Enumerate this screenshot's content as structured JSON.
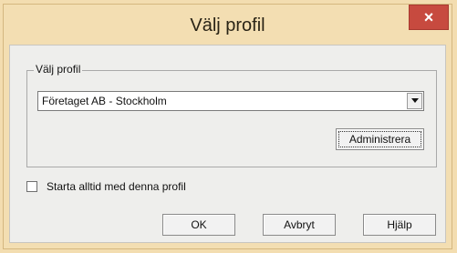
{
  "window": {
    "title": "Välj profil",
    "close_glyph": "×"
  },
  "group": {
    "legend": "Välj profil",
    "profile_select": {
      "selected_value": "Företaget AB - Stockholm"
    },
    "admin_button_label": "Administrera"
  },
  "options": {
    "always_start_label": "Starta alltid med denna profil",
    "always_start_checked": false
  },
  "buttons": {
    "ok_label": "OK",
    "cancel_label": "Avbryt",
    "help_label": "Hjälp"
  },
  "colors": {
    "title_bar": "#f3deb2",
    "close_button": "#c74a3f",
    "client_bg": "#eeeeec"
  },
  "icons": {
    "close": "close-icon",
    "dropdown": "chevron-down-icon"
  }
}
